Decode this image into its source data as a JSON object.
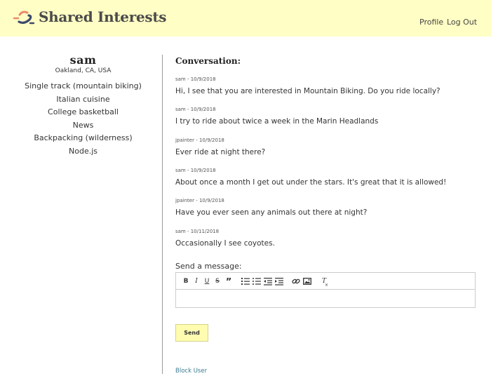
{
  "header": {
    "brand": "Shared Interests",
    "nav": {
      "profile": "Profile",
      "logout": "Log Out"
    },
    "colors": {
      "background": "#fffec4",
      "logo_orange": "#e98a6c",
      "logo_navy": "#3e4a6d"
    }
  },
  "sidebar": {
    "name": "sam",
    "location": "Oakland, CA, USA",
    "interests": [
      "Single track (mountain biking)",
      "Italian cuisine",
      "College basketball",
      "News",
      "Backpacking (wilderness)",
      "Node.js"
    ]
  },
  "conversation": {
    "title": "Conversation:",
    "messages": [
      {
        "meta": "sam - 10/9/2018",
        "text": "Hi, I see that you are interested in Mountain Biking. Do you ride locally?"
      },
      {
        "meta": "sam - 10/9/2018",
        "text": "I try to ride about twice a week in the Marin Headlands"
      },
      {
        "meta": "jpainter - 10/9/2018",
        "text": "Ever ride at night there?"
      },
      {
        "meta": "sam - 10/9/2018",
        "text": "About once a month I get out under the stars. It's great that it is allowed!"
      },
      {
        "meta": "jpainter - 10/9/2018",
        "text": "Have you ever seen any animals out there at night?"
      },
      {
        "meta": "sam - 10/11/2018",
        "text": "Occasionally I see coyotes."
      }
    ]
  },
  "composer": {
    "label": "Send a message:",
    "toolbar_icons": [
      "bold-icon",
      "italic-icon",
      "underline-icon",
      "strikethrough-icon",
      "blockquote-icon",
      "ordered-list-icon",
      "bullet-list-icon",
      "outdent-icon",
      "indent-icon",
      "link-icon",
      "image-icon",
      "clear-format-icon"
    ],
    "toolbar_glyphs": {
      "bold": "B",
      "italic": "I",
      "underline": "U",
      "strike": "S",
      "quote": "”",
      "clear": "T"
    },
    "send_label": "Send",
    "send_color": "#fffcb0"
  },
  "footer": {
    "block_user": "Block User",
    "link_color": "#3a7c8f"
  }
}
